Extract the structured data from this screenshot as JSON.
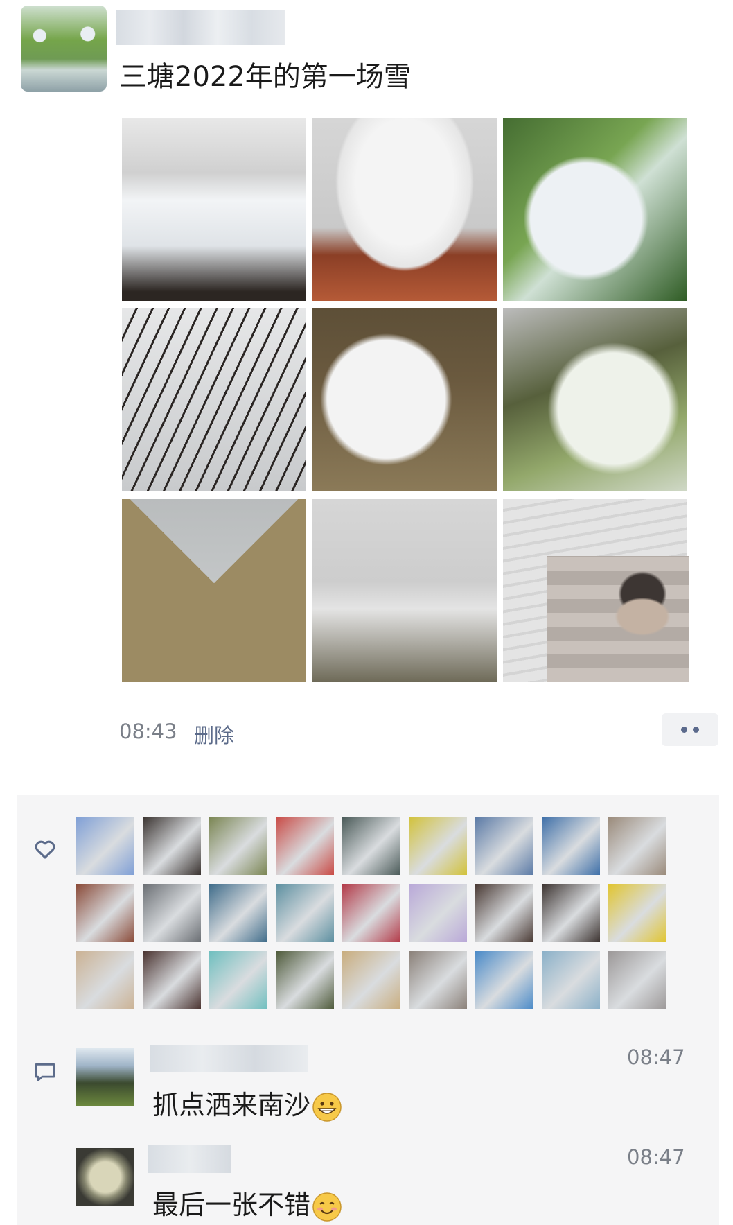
{
  "post": {
    "text": "三塘2022年的第一场雪",
    "time": "08:43",
    "delete_label": "删除"
  },
  "photos_count": 9,
  "likers_count": 27,
  "comments": [
    {
      "text": "抓点洒来南沙",
      "time": "08:47",
      "emoji": "grinning-face"
    },
    {
      "text": "最后一张不错",
      "time": "08:47",
      "emoji": "smiling-face"
    }
  ],
  "icons": [
    "heart-icon",
    "comment-icon",
    "more-dots-icon"
  ],
  "colors": {
    "link": "#5c6b8a",
    "timestamp": "#7a7f88",
    "panel_bg": "#f5f5f6"
  }
}
